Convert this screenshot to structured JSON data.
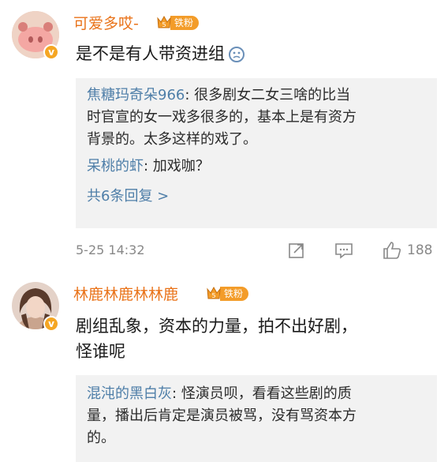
{
  "comments": [
    {
      "username": "可爱多哎-",
      "badge_label": "铁粉",
      "badge_level": "5",
      "text": "是不是有人带资进组",
      "replies": [
        {
          "name": "焦糖玛奇朵966",
          "sep": ":",
          "line1": " 很多剧女二女三啥的比当",
          "line2": "时官宣的女一戏多很多的，基本上是有资方",
          "line3": "背景的。太多这样的戏了。"
        },
        {
          "name": "呆桃的虾",
          "sep": ":",
          "line1": " 加戏咖？"
        }
      ],
      "more_replies": "共6条回复 >",
      "timestamp": "5-25 14:32",
      "like_count": "188"
    },
    {
      "username": "林鹿林鹿林林鹿",
      "badge_label": "铁粉",
      "badge_level": "5",
      "text_line1": "剧组乱象，资本的力量，拍不出好剧，",
      "text_line2": "怪谁呢",
      "replies": [
        {
          "name": "混沌的黑白灰",
          "sep": ":",
          "line1": " 怪演员呗，看看这些剧的质",
          "line2": "量，播出后肯定是演员被骂，没有骂资本方",
          "line3": "的。"
        }
      ]
    }
  ],
  "icons": {
    "vip": "v-badge-icon",
    "share": "share-icon",
    "comment": "comment-icon",
    "like": "thumb-up-icon",
    "emoji": "thinking-emoji-icon"
  },
  "colors": {
    "username": "#e9731a",
    "reply_name": "#4e7ea8",
    "badge": "#f39c29",
    "reply_bg": "#f2f2f2"
  }
}
